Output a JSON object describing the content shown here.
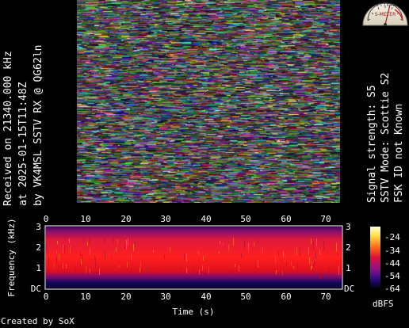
{
  "received": {
    "line1": "Received on  21340.000 kHz",
    "line2": "at 2025-01-15T11:48Z",
    "line3": "by VK4MSL SSTV RX @ QG62ln"
  },
  "signal": {
    "strength": "Signal strength: S5",
    "mode": "SSTV Mode: Scottie S2",
    "fsk": "FSK ID not Known"
  },
  "s_meter": {
    "label": "S-METER",
    "scale": "1 3 5 7 9 +20"
  },
  "spectrogram": {
    "ylabel": "Frequency (kHz)",
    "xlabel": "Time (s)",
    "x_ticks": [
      "0",
      "10",
      "20",
      "30",
      "40",
      "50",
      "60",
      "70"
    ],
    "y_ticks_left": [
      "DC",
      "1",
      "2",
      "3"
    ],
    "y_ticks_right": [
      "DC",
      "1",
      "2",
      "3"
    ],
    "colorbar_ticks": [
      "-24",
      "-34",
      "-44",
      "-54",
      "-64"
    ],
    "colorbar_unit": "dBFS"
  },
  "credit": "Created by SoX"
}
